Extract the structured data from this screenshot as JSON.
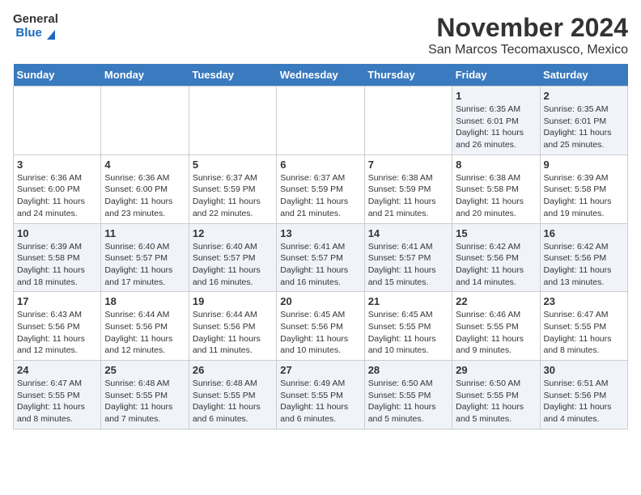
{
  "header": {
    "logo_line1": "General",
    "logo_line2": "Blue",
    "title": "November 2024",
    "subtitle": "San Marcos Tecomaxusco, Mexico"
  },
  "days_of_week": [
    "Sunday",
    "Monday",
    "Tuesday",
    "Wednesday",
    "Thursday",
    "Friday",
    "Saturday"
  ],
  "weeks": [
    [
      {
        "day": "",
        "info": ""
      },
      {
        "day": "",
        "info": ""
      },
      {
        "day": "",
        "info": ""
      },
      {
        "day": "",
        "info": ""
      },
      {
        "day": "",
        "info": ""
      },
      {
        "day": "1",
        "info": "Sunrise: 6:35 AM\nSunset: 6:01 PM\nDaylight: 11 hours and 26 minutes."
      },
      {
        "day": "2",
        "info": "Sunrise: 6:35 AM\nSunset: 6:01 PM\nDaylight: 11 hours and 25 minutes."
      }
    ],
    [
      {
        "day": "3",
        "info": "Sunrise: 6:36 AM\nSunset: 6:00 PM\nDaylight: 11 hours and 24 minutes."
      },
      {
        "day": "4",
        "info": "Sunrise: 6:36 AM\nSunset: 6:00 PM\nDaylight: 11 hours and 23 minutes."
      },
      {
        "day": "5",
        "info": "Sunrise: 6:37 AM\nSunset: 5:59 PM\nDaylight: 11 hours and 22 minutes."
      },
      {
        "day": "6",
        "info": "Sunrise: 6:37 AM\nSunset: 5:59 PM\nDaylight: 11 hours and 21 minutes."
      },
      {
        "day": "7",
        "info": "Sunrise: 6:38 AM\nSunset: 5:59 PM\nDaylight: 11 hours and 21 minutes."
      },
      {
        "day": "8",
        "info": "Sunrise: 6:38 AM\nSunset: 5:58 PM\nDaylight: 11 hours and 20 minutes."
      },
      {
        "day": "9",
        "info": "Sunrise: 6:39 AM\nSunset: 5:58 PM\nDaylight: 11 hours and 19 minutes."
      }
    ],
    [
      {
        "day": "10",
        "info": "Sunrise: 6:39 AM\nSunset: 5:58 PM\nDaylight: 11 hours and 18 minutes."
      },
      {
        "day": "11",
        "info": "Sunrise: 6:40 AM\nSunset: 5:57 PM\nDaylight: 11 hours and 17 minutes."
      },
      {
        "day": "12",
        "info": "Sunrise: 6:40 AM\nSunset: 5:57 PM\nDaylight: 11 hours and 16 minutes."
      },
      {
        "day": "13",
        "info": "Sunrise: 6:41 AM\nSunset: 5:57 PM\nDaylight: 11 hours and 16 minutes."
      },
      {
        "day": "14",
        "info": "Sunrise: 6:41 AM\nSunset: 5:57 PM\nDaylight: 11 hours and 15 minutes."
      },
      {
        "day": "15",
        "info": "Sunrise: 6:42 AM\nSunset: 5:56 PM\nDaylight: 11 hours and 14 minutes."
      },
      {
        "day": "16",
        "info": "Sunrise: 6:42 AM\nSunset: 5:56 PM\nDaylight: 11 hours and 13 minutes."
      }
    ],
    [
      {
        "day": "17",
        "info": "Sunrise: 6:43 AM\nSunset: 5:56 PM\nDaylight: 11 hours and 12 minutes."
      },
      {
        "day": "18",
        "info": "Sunrise: 6:44 AM\nSunset: 5:56 PM\nDaylight: 11 hours and 12 minutes."
      },
      {
        "day": "19",
        "info": "Sunrise: 6:44 AM\nSunset: 5:56 PM\nDaylight: 11 hours and 11 minutes."
      },
      {
        "day": "20",
        "info": "Sunrise: 6:45 AM\nSunset: 5:56 PM\nDaylight: 11 hours and 10 minutes."
      },
      {
        "day": "21",
        "info": "Sunrise: 6:45 AM\nSunset: 5:55 PM\nDaylight: 11 hours and 10 minutes."
      },
      {
        "day": "22",
        "info": "Sunrise: 6:46 AM\nSunset: 5:55 PM\nDaylight: 11 hours and 9 minutes."
      },
      {
        "day": "23",
        "info": "Sunrise: 6:47 AM\nSunset: 5:55 PM\nDaylight: 11 hours and 8 minutes."
      }
    ],
    [
      {
        "day": "24",
        "info": "Sunrise: 6:47 AM\nSunset: 5:55 PM\nDaylight: 11 hours and 8 minutes."
      },
      {
        "day": "25",
        "info": "Sunrise: 6:48 AM\nSunset: 5:55 PM\nDaylight: 11 hours and 7 minutes."
      },
      {
        "day": "26",
        "info": "Sunrise: 6:48 AM\nSunset: 5:55 PM\nDaylight: 11 hours and 6 minutes."
      },
      {
        "day": "27",
        "info": "Sunrise: 6:49 AM\nSunset: 5:55 PM\nDaylight: 11 hours and 6 minutes."
      },
      {
        "day": "28",
        "info": "Sunrise: 6:50 AM\nSunset: 5:55 PM\nDaylight: 11 hours and 5 minutes."
      },
      {
        "day": "29",
        "info": "Sunrise: 6:50 AM\nSunset: 5:55 PM\nDaylight: 11 hours and 5 minutes."
      },
      {
        "day": "30",
        "info": "Sunrise: 6:51 AM\nSunset: 5:56 PM\nDaylight: 11 hours and 4 minutes."
      }
    ]
  ]
}
